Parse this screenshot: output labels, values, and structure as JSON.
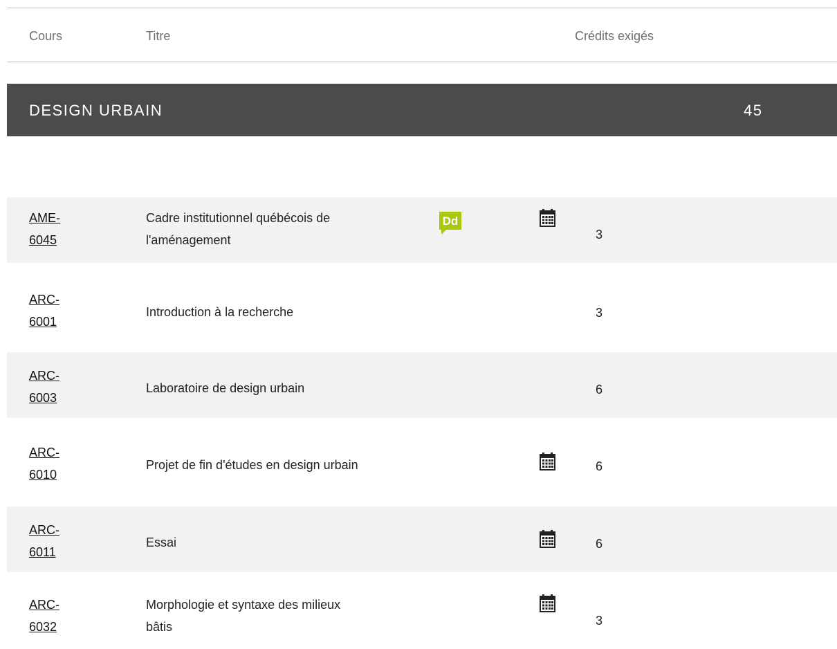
{
  "table": {
    "columns": {
      "course": "Cours",
      "title": "Titre",
      "credits": "Crédits exigés"
    }
  },
  "section": {
    "name": "DESIGN URBAIN",
    "total_credits": "45"
  },
  "icons": {
    "dd": "dd-speech-badge-icon",
    "calendar": "calendar-icon",
    "dd_color": "#a8c80a"
  },
  "rows": [
    {
      "code_prefix": "AME-",
      "code_num": "6045",
      "title_line1": "Cadre institutionnel québécois de",
      "title_line2": "l'aménagement",
      "credits": "3"
    },
    {
      "code_prefix": "ARC-",
      "code_num": "6001",
      "title_line1": "Introduction à la recherche",
      "credits": "3"
    },
    {
      "code_prefix": "ARC-",
      "code_num": "6003",
      "title_line1": "Laboratoire de design urbain",
      "credits": "6"
    },
    {
      "code_prefix": "ARC-",
      "code_num": "6010",
      "title_line1": "Projet de fin d'études en design urbain",
      "credits": "6"
    },
    {
      "code_prefix": "ARC-",
      "code_num": "6011",
      "title_line1": "Essai",
      "credits": "6"
    },
    {
      "code_prefix": "ARC-",
      "code_num": "6032",
      "title_line1": "Morphologie et syntaxe des milieux",
      "title_line2": "bâtis",
      "credits": "3"
    }
  ]
}
